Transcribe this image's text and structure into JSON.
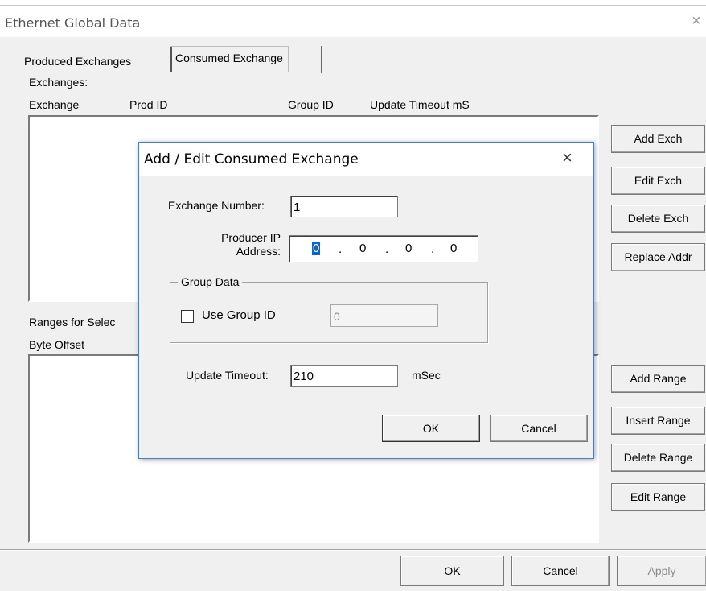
{
  "window": {
    "title": "Ethernet Global Data",
    "close_glyph": "×"
  },
  "tabs": [
    "Produced Exchanges",
    "Consumed Exchange"
  ],
  "exchanges": {
    "label": "Exchanges:",
    "columns": [
      "Exchange",
      "Prod ID",
      "Group ID",
      "Update Timeout mS"
    ]
  },
  "side_buttons": [
    "Add Exch",
    "Edit Exch",
    "Delete Exch",
    "Replace Addr"
  ],
  "ranges": {
    "label": "Ranges for Selec",
    "columns": [
      "Byte Offset"
    ]
  },
  "range_buttons": [
    "Add Range",
    "Insert Range",
    "Delete Range",
    "Edit Range"
  ],
  "footer": {
    "ok": "OK",
    "cancel": "Cancel",
    "apply": "Apply"
  },
  "dialog": {
    "title": "Add / Edit Consumed Exchange",
    "close_glyph": "×",
    "exchange_number_label": "Exchange Number:",
    "exchange_number_value": "1",
    "producer_ip_label_1": "Producer IP",
    "producer_ip_label_2": "Address:",
    "producer_ip": [
      "0",
      "0",
      "0",
      "0"
    ],
    "ip_dot": ".",
    "group_data_label": "Group Data",
    "use_group_id_label": "Use Group ID",
    "use_group_id_checked": false,
    "group_id_value": "0",
    "update_timeout_label": "Update Timeout:",
    "update_timeout_value": "210",
    "update_timeout_unit": "mSec",
    "ok": "OK",
    "cancel": "Cancel"
  }
}
